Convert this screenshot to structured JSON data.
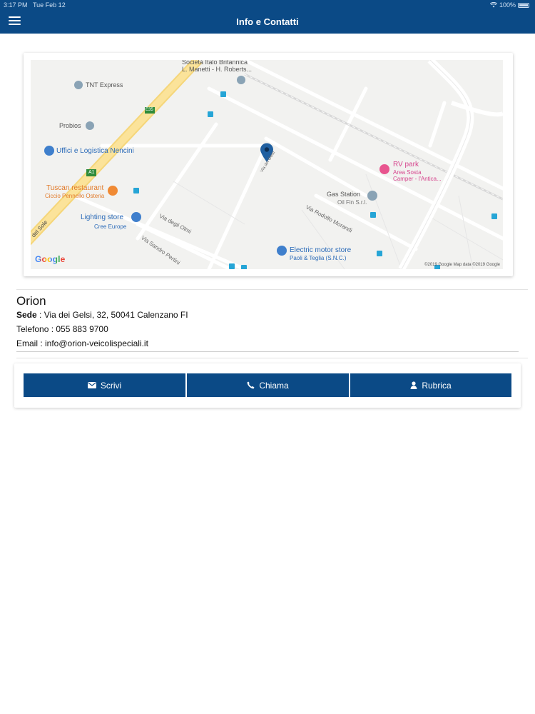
{
  "status_bar": {
    "time": "3:17 PM",
    "date": "Tue Feb 12",
    "battery": "100%"
  },
  "header": {
    "title": "Info e Contatti"
  },
  "map": {
    "labels": {
      "societa": "Società Italo Britannica",
      "manetti": "L. Manetti - H. Roberts...",
      "tnt": "TNT Express",
      "probios": "Probios",
      "uffici": "Uffici e Logistica Nencini",
      "tuscan": "Tuscan restaurant",
      "ciccio": "Ciccio Pennello Osteria",
      "rvpark": "RV park",
      "rvpark_sub1": "Area Sosta",
      "rvpark_sub2": "Camper - l'Antica...",
      "gas": "Gas Station",
      "gas_sub": "Oil Fin S.r.l.",
      "lighting": "Lighting store",
      "lighting_sub": "Cree Europe",
      "electric": "Electric motor store",
      "electric_sub": "Paoli & Teglia (S.N.C.)",
      "road_olmi": "Via degli Olmi",
      "road_pertini": "Via Sandro Pertini",
      "road_morandi": "Via Rodolfo Morandi",
      "road_gelsi": "Via dei Gelsi",
      "road_sole": "del Sole",
      "road_a1": "A1",
      "road_e35": "E35",
      "google": "Google",
      "attribution": "©2019 Google   Map data ©2019 Google"
    }
  },
  "contact": {
    "company": "Orion",
    "sede_label": "Sede",
    "sede_value": " : Via dei Gelsi, 32, 50041 Calenzano FI",
    "telefono": "Telefono : 055 883 9700",
    "email": "Email : info@orion-veicolispeciali.it"
  },
  "actions": {
    "write": "Scrivi",
    "call": "Chiama",
    "contacts": "Rubrica"
  },
  "colors": {
    "primary": "#0b4a86",
    "pin": "#1f5fa0"
  },
  "icons": [
    "menu-icon",
    "wifi-icon",
    "battery-icon",
    "map-pin-icon",
    "envelope-icon",
    "phone-icon",
    "person-icon"
  ]
}
